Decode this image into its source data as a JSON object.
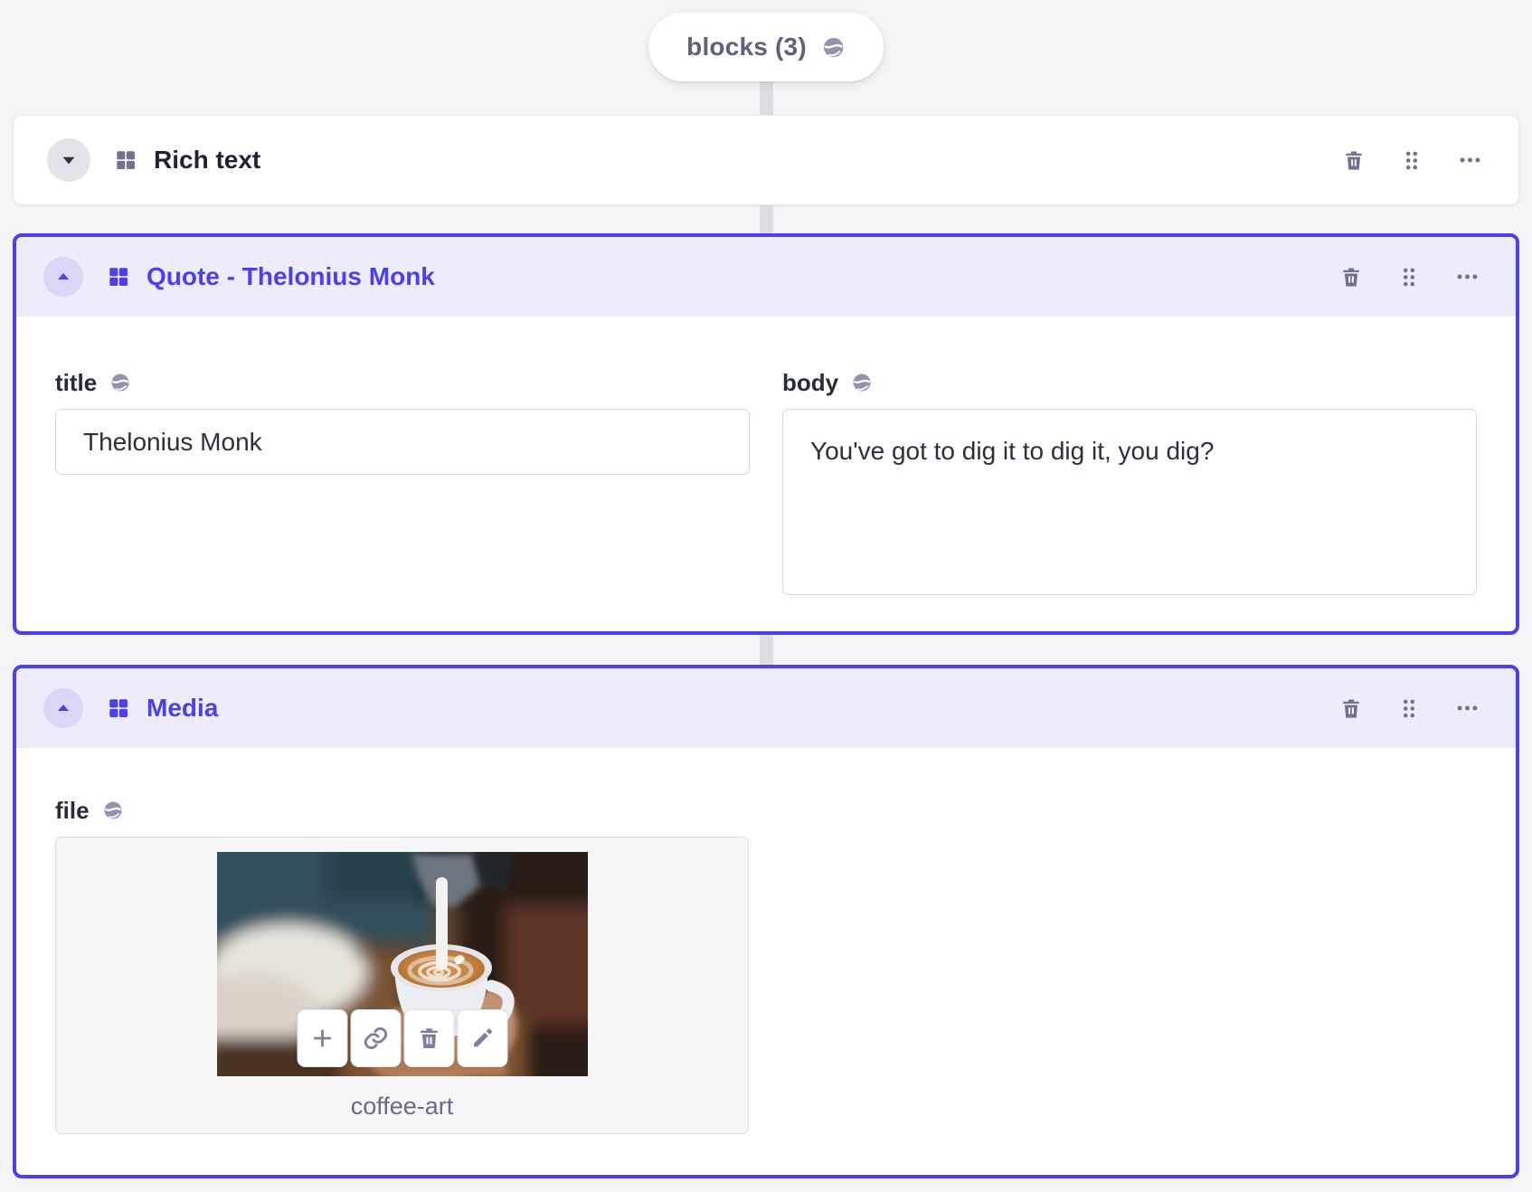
{
  "accent_color": "#4b3fee",
  "array_pill": {
    "label": "blocks (3)",
    "icon": "globe-icon"
  },
  "blocks": [
    {
      "title": "Rich text",
      "state": "collapsed"
    },
    {
      "title": "Quote - Thelonius Monk",
      "state": "expanded",
      "fields": {
        "title": {
          "label": "title",
          "value": "Thelonius Monk",
          "icon": "globe-icon"
        },
        "body": {
          "label": "body",
          "value": "You've got to dig it to dig it, you dig?",
          "icon": "globe-icon"
        }
      }
    },
    {
      "title": "Media",
      "state": "expanded",
      "fields": {
        "file": {
          "label": "file",
          "filename": "coffee-art",
          "icon": "globe-icon",
          "toolbar_icons": [
            "plus-icon",
            "link-icon",
            "trash-icon",
            "pencil-icon"
          ]
        }
      }
    }
  ],
  "header_control_icons": [
    "trash-icon",
    "drag-handle-icon",
    "ellipsis-icon"
  ]
}
